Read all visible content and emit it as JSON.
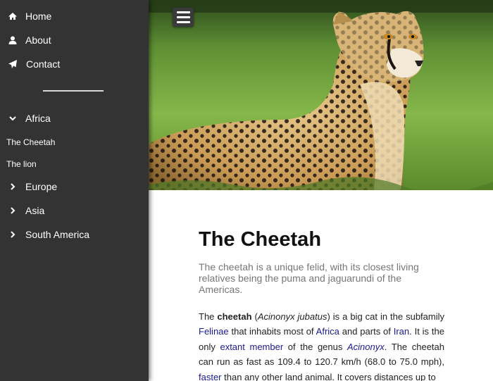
{
  "sidebar": {
    "nav": [
      {
        "label": "Home",
        "icon": "home-icon"
      },
      {
        "label": "About",
        "icon": "user-icon"
      },
      {
        "label": "Contact",
        "icon": "paper-plane-icon"
      }
    ],
    "regions": [
      {
        "label": "Africa",
        "icon": "chevron-down-icon",
        "expanded": true,
        "children": [
          "The Cheetah",
          "The lion"
        ]
      },
      {
        "label": "Europe",
        "icon": "chevron-right-icon"
      },
      {
        "label": "Asia",
        "icon": "chevron-right-icon"
      },
      {
        "label": "South America",
        "icon": "chevron-right-icon"
      }
    ]
  },
  "header": {
    "menu_button_icon": "hamburger-menu-icon"
  },
  "article": {
    "title": "The Cheetah",
    "lead": "The cheetah is a unique felid, with its closest living relatives being the puma and jaguarundi of the Americas.",
    "body": {
      "p1": "The ",
      "bold_name": "cheetah",
      "p2": " (",
      "scientific": "Acinonyx jubatus",
      "p3": ") is a big cat in the subfamily ",
      "link_felinae": "Felinae",
      "p4": " that inhabits most of ",
      "link_africa": "Africa",
      "p5": " and parts of ",
      "link_iran": "Iran",
      "p6": ". It is the only ",
      "link_extant": "extant member",
      "p7": " of the genus ",
      "link_acinonyx": "Acinonyx",
      "p8": ". The cheetah can run as fast as 109.4 to 120.7 km/h (68.0 to 75.0 mph), ",
      "link_faster": "faster",
      "p9": " than any other land animal. It covers distances up to"
    }
  },
  "colors": {
    "sidebar_bg": "#333333",
    "link": "#1a1a8c",
    "lead_text": "#777777"
  }
}
